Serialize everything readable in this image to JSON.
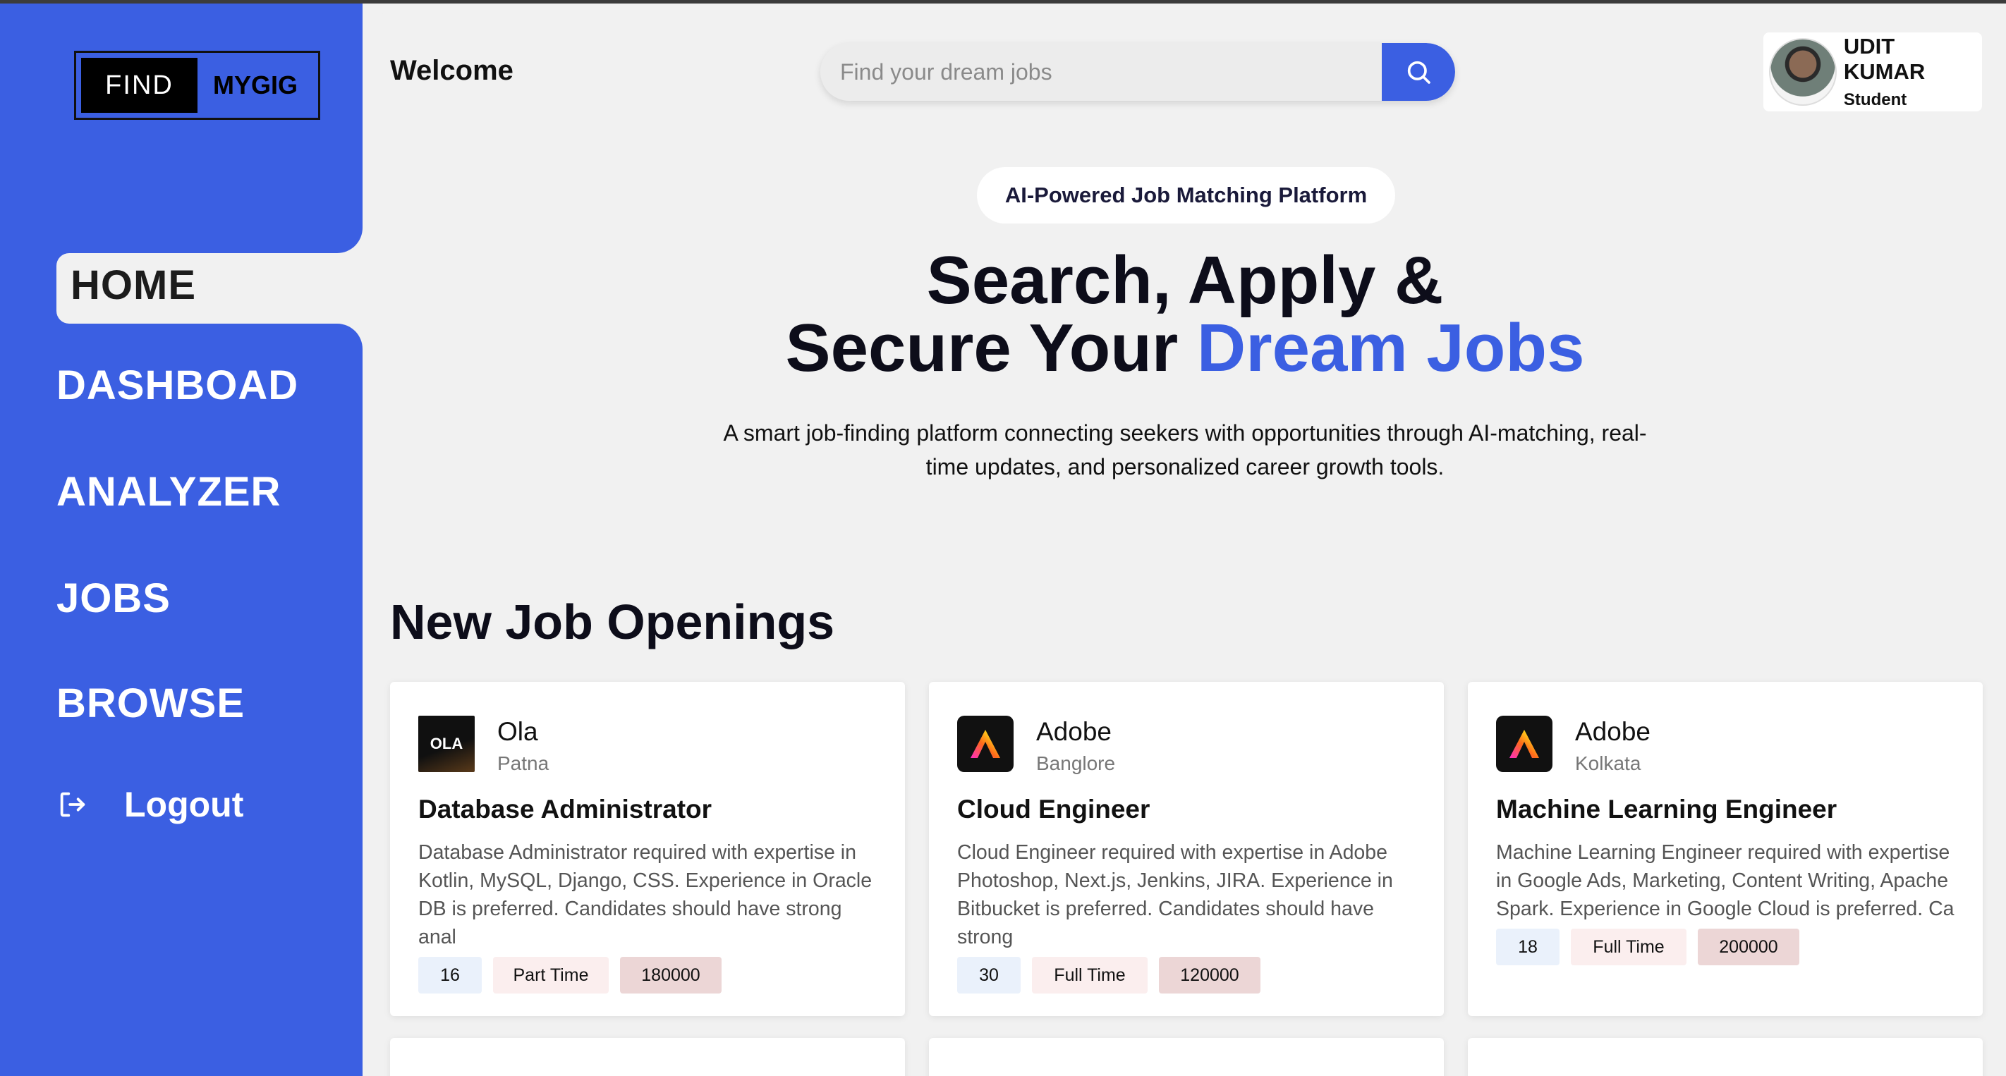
{
  "app": {
    "logo_left": "FIND",
    "logo_right": "MYGIG"
  },
  "nav": {
    "home": "HOME",
    "dashboard": "DASHBOAD",
    "analyzer": "ANALYZER",
    "jobs": "JOBS",
    "browse": "BROWSE",
    "logout": "Logout"
  },
  "header": {
    "welcome": "Welcome",
    "search_placeholder": "Find your dream jobs",
    "search_icon": "search-icon"
  },
  "user": {
    "name": "UDIT KUMAR",
    "role": "Student"
  },
  "hero": {
    "badge": "AI-Powered Job Matching Platform",
    "title_line1": "Search, Apply &",
    "title_line2_prefix": "Secure Your",
    "title_line2_accent": "Dream Jobs",
    "description": "A smart job-finding platform connecting seekers with opportunities through AI-matching, real-time updates, and personalized career growth tools."
  },
  "jobs": {
    "section_title": "New Job Openings",
    "cards": [
      {
        "company": "Ola",
        "logo_text": "OLA",
        "location": "Patna",
        "title": "Database Administrator",
        "description": "Database Administrator required with expertise in Kotlin, MySQL, Django, CSS. Experience in Oracle DB is preferred. Candidates should have strong anal",
        "positions": "16",
        "job_type": "Part Time",
        "salary": "180000"
      },
      {
        "company": "Adobe",
        "location": "Banglore",
        "title": "Cloud Engineer",
        "description": "Cloud Engineer required with expertise in Adobe Photoshop, Next.js, Jenkins, JIRA. Experience in Bitbucket is preferred. Candidates should have strong",
        "positions": "30",
        "job_type": "Full Time",
        "salary": "120000"
      },
      {
        "company": "Adobe",
        "location": "Kolkata",
        "title": "Machine Learning Engineer",
        "description": "Machine Learning Engineer required with expertise in Google Ads, Marketing, Content Writing, Apache Spark. Experience in Google Cloud is preferred. Ca",
        "positions": "18",
        "job_type": "Full Time",
        "salary": "200000"
      }
    ]
  },
  "colors": {
    "primary": "#3b5fe2",
    "background": "#f1f1f1"
  }
}
